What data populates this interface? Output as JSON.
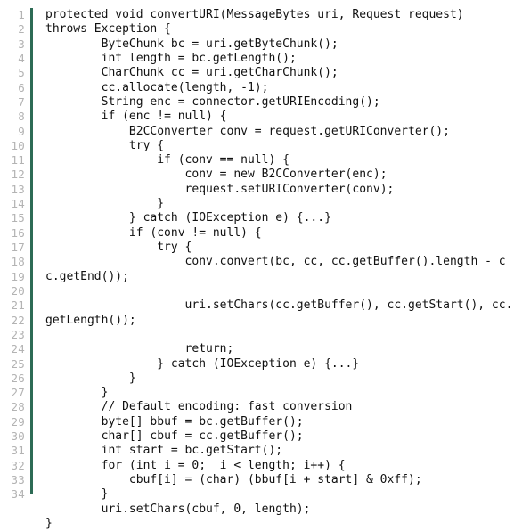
{
  "viewer": {
    "kind": "code-listing",
    "language": "Java",
    "total_lines": 34,
    "gutter_rule_color": "#2d6b55",
    "line_number_color": "#b3b3b3",
    "code_color": "#111111",
    "background_color": "#ffffff"
  },
  "line_numbers": [
    "1",
    "2",
    "3",
    "4",
    "5",
    "6",
    "7",
    "8",
    "9",
    "10",
    "11",
    "12",
    "13",
    "14",
    "15",
    "16",
    "17",
    "18",
    "19",
    "20",
    "21",
    "22",
    "23",
    "24",
    "25",
    "26",
    "27",
    "28",
    "29",
    "30",
    "31",
    "32",
    "33",
    "34"
  ],
  "code_lines": [
    "protected void convertURI(MessageBytes uri, Request request)",
    "throws Exception {",
    "        ByteChunk bc = uri.getByteChunk();",
    "        int length = bc.getLength();",
    "        CharChunk cc = uri.getCharChunk();",
    "        cc.allocate(length, -1);",
    "        String enc = connector.getURIEncoding();",
    "        if (enc != null) {",
    "            B2CConverter conv = request.getURIConverter();",
    "            try {",
    "                if (conv == null) {",
    "                    conv = new B2CConverter(enc);",
    "                    request.setURIConverter(conv);",
    "                }",
    "            } catch (IOException e) {...}",
    "            if (conv != null) {",
    "                try {",
    "                    conv.convert(bc, cc, cc.getBuffer().length - cc.getEnd());",
    "",
    "                    uri.setChars(cc.getBuffer(), cc.getStart(), cc.getLength());",
    "",
    "                    return;",
    "                } catch (IOException e) {...}",
    "            }",
    "        }",
    "        // Default encoding: fast conversion",
    "        byte[] bbuf = bc.getBuffer();",
    "        char[] cbuf = cc.getBuffer();",
    "        int start = bc.getStart();",
    "        for (int i = 0;  i < length; i++) {",
    "            cbuf[i] = (char) (bbuf[i + start] & 0xff);",
    "        }",
    "        uri.setChars(cbuf, 0, length);",
    "}"
  ]
}
